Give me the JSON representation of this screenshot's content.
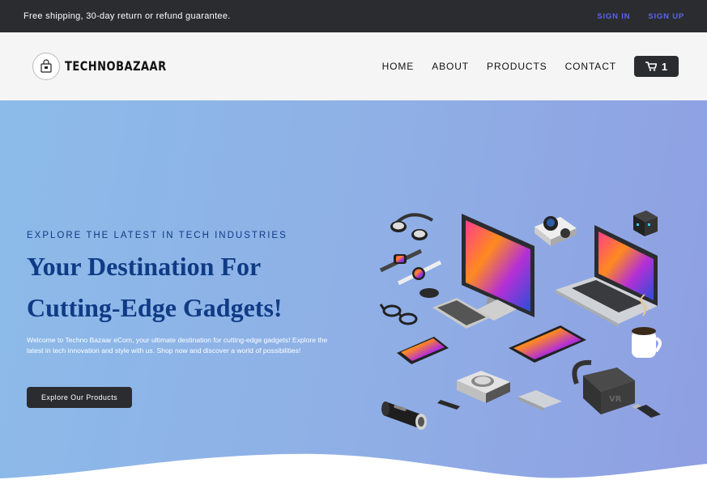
{
  "topbar": {
    "promo": "Free shipping, 30-day return or refund guarantee.",
    "sign_in": "SIGN IN",
    "sign_up": "SIGN UP"
  },
  "header": {
    "brand": "TECHNOBAZAAR",
    "nav": [
      "HOME",
      "ABOUT",
      "PRODUCTS",
      "CONTACT"
    ],
    "cart_count": "1"
  },
  "hero": {
    "eyebrow": "EXPLORE THE LATEST IN TECH INDUSTRIES",
    "headline_line1": "Your Destination For",
    "headline_line2": "Cutting-Edge Gadgets!",
    "blurb": "Welcome to Techno Bazaar eCom, your ultimate destination for cutting-edge gadgets! Explore the latest in tech innovation and style with us. Shop now and discover a world of possibilities!",
    "cta": "Explore Our Products"
  },
  "colors": {
    "topbar_bg": "#2b2c30",
    "auth_link": "#5b63ee",
    "headline": "#0f3b86",
    "hero_gradient_start": "#8cbbe9",
    "hero_gradient_end": "#8f9fe2"
  },
  "icons": [
    "shopping-bag-logo-icon",
    "cart-icon",
    "gadgets-illustration"
  ]
}
